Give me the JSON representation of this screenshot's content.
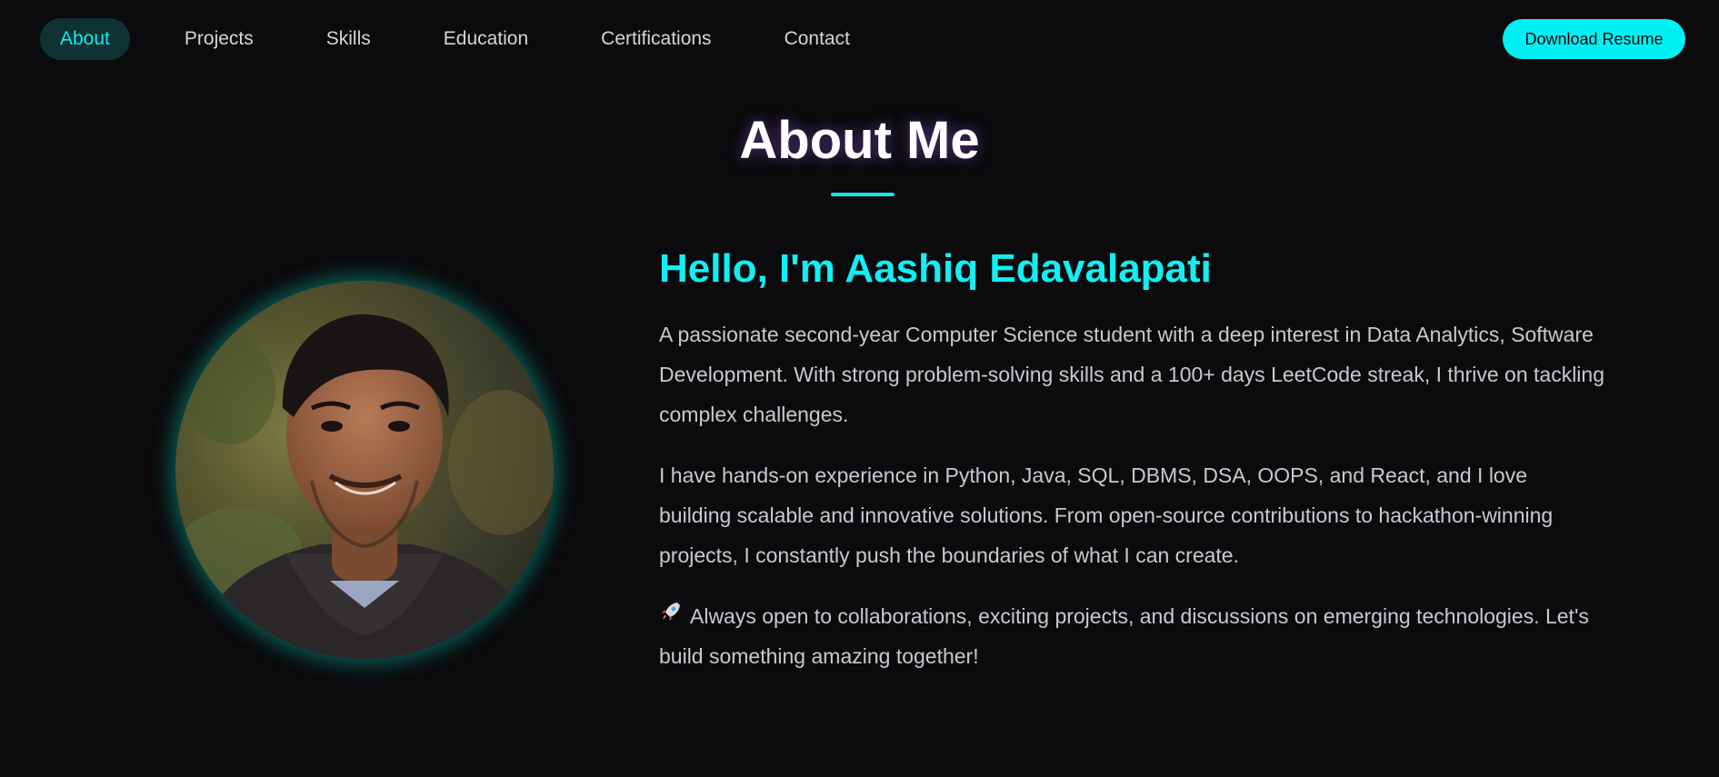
{
  "nav": {
    "items": [
      {
        "label": "About",
        "active": true
      },
      {
        "label": "Projects",
        "active": false
      },
      {
        "label": "Skills",
        "active": false
      },
      {
        "label": "Education",
        "active": false
      },
      {
        "label": "Certifications",
        "active": false
      },
      {
        "label": "Contact",
        "active": false
      }
    ],
    "resume_button": "Download Resume"
  },
  "about": {
    "title": "About Me",
    "greeting": "Hello, I'm Aashiq Edavalapati",
    "paragraphs": [
      "A passionate second-year Computer Science student with a deep interest in Data Analytics, Software Development. With strong problem-solving skills and a 100+ days LeetCode streak, I thrive on tackling complex challenges.",
      "I have hands-on experience in Python, Java, SQL, DBMS, DSA, OOPS, and React, and I love building scalable and innovative solutions. From open-source contributions to hackathon-winning projects, I constantly push the boundaries of what I can create.",
      "Always open to collaborations, exciting projects, and discussions on emerging technologies. Let's build something amazing together!"
    ],
    "rocket_icon": "rocket-icon",
    "profile_photo": "profile-photo"
  },
  "colors": {
    "background": "#0b0a0c",
    "accent": "#00f0f4",
    "active_nav_bg": "#0f3233",
    "text": "#c9c9cf"
  }
}
